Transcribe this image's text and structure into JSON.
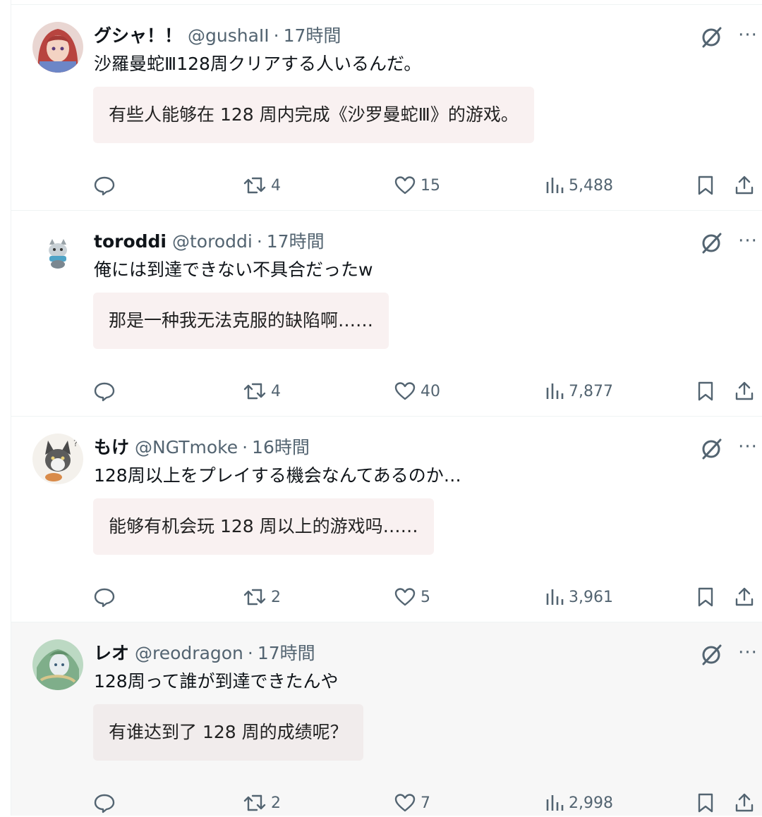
{
  "tweets": [
    {
      "name": "グシャ！！",
      "handle": "@gushaII",
      "time": "17時間",
      "text": "沙羅曼蛇Ⅲ128周クリアする人いるんだ。",
      "translation": "有些人能够在 128 周内完成《沙罗曼蛇Ⅲ》的游戏。",
      "replies": "",
      "retweets": "4",
      "likes": "15",
      "views": "5,488",
      "avatar_color": "#c45a5a"
    },
    {
      "name": "toroddi",
      "handle": "@toroddi",
      "time": "17時間",
      "text": "俺には到達できない不具合だったw",
      "translation": "那是一种我无法克服的缺陷啊……",
      "replies": "",
      "retweets": "4",
      "likes": "40",
      "views": "7,877",
      "avatar_color": "#7fb6c9"
    },
    {
      "name": "もけ",
      "handle": "@NGTmoke",
      "time": "16時間",
      "text": "128周以上をプレイする機会なんてあるのか…",
      "translation": "能够有机会玩 128 周以上的游戏吗……",
      "replies": "",
      "retweets": "2",
      "likes": "5",
      "views": "3,961",
      "avatar_color": "#6b6b6b"
    },
    {
      "name": "レオ",
      "handle": "@reodragon",
      "time": "17時間",
      "text": "128周って誰が到達できたんや",
      "translation": "有谁达到了 128 周的成绩呢？",
      "replies": "",
      "retweets": "2",
      "likes": "7",
      "views": "2,998",
      "avatar_color": "#8fb99a"
    }
  ],
  "separator": "·",
  "more_label": "···",
  "colors": {
    "text": "#0f1419",
    "secondary": "#536471",
    "translation_bg": "#f9f1f1",
    "highlight_bg": "#f7f7f7"
  },
  "icons": [
    "reply-icon",
    "retweet-icon",
    "like-icon",
    "views-icon",
    "bookmark-icon",
    "share-icon",
    "grok-icon",
    "more-icon"
  ]
}
